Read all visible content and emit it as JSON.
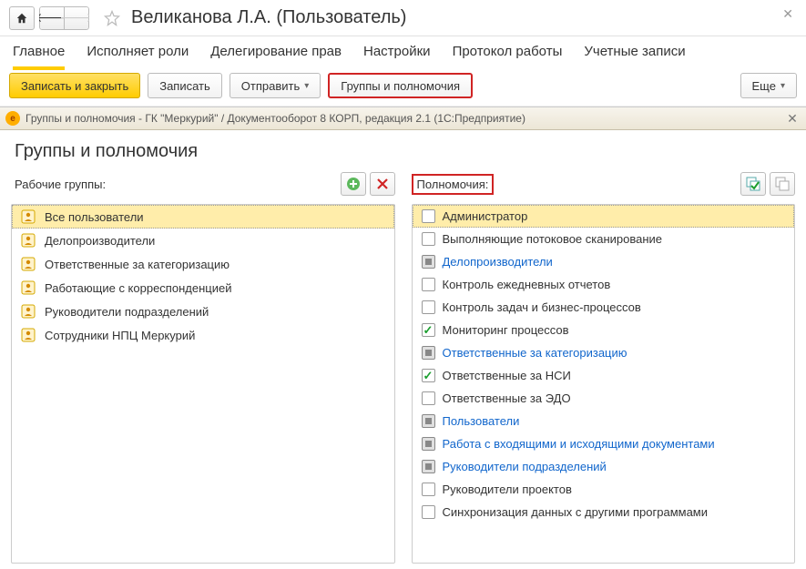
{
  "header": {
    "title": "Великанова Л.А. (Пользователь)"
  },
  "tabs": [
    {
      "label": "Главное",
      "active": true
    },
    {
      "label": "Исполняет роли",
      "active": false
    },
    {
      "label": "Делегирование прав",
      "active": false
    },
    {
      "label": "Настройки",
      "active": false
    },
    {
      "label": "Протокол работы",
      "active": false
    },
    {
      "label": "Учетные записи",
      "active": false
    }
  ],
  "toolbar": {
    "save_close": "Записать и закрыть",
    "save": "Записать",
    "send": "Отправить",
    "groups_perms": "Группы и полномочия",
    "more": "Еще"
  },
  "subwin": {
    "title_bar": "Группы и полномочия - ГК \"Меркурий\" / Документооборот 8 КОРП, редакция 2.1  (1С:Предприятие)",
    "heading": "Группы и полномочия"
  },
  "groups": {
    "label": "Рабочие группы:",
    "items": [
      {
        "label": "Все пользователи",
        "selected": true
      },
      {
        "label": "Делопроизводители"
      },
      {
        "label": "Ответственные за категоризацию"
      },
      {
        "label": "Работающие с корреспонденцией"
      },
      {
        "label": "Руководители подразделений"
      },
      {
        "label": "Сотрудники НПЦ Меркурий"
      }
    ]
  },
  "perms": {
    "label": "Полномочия:",
    "items": [
      {
        "label": "Администратор",
        "state": "empty",
        "selected": true,
        "link": false
      },
      {
        "label": "Выполняющие потоковое сканирование",
        "state": "empty",
        "link": false
      },
      {
        "label": "Делопроизводители",
        "state": "group",
        "link": true
      },
      {
        "label": "Контроль ежедневных отчетов",
        "state": "empty",
        "link": false
      },
      {
        "label": "Контроль задач и бизнес-процессов",
        "state": "empty",
        "link": false
      },
      {
        "label": "Мониторинг процессов",
        "state": "checked",
        "link": false
      },
      {
        "label": "Ответственные за категоризацию",
        "state": "group",
        "link": true
      },
      {
        "label": "Ответственные за НСИ",
        "state": "checked",
        "link": false
      },
      {
        "label": "Ответственные за ЭДО",
        "state": "empty",
        "link": false
      },
      {
        "label": "Пользователи",
        "state": "group",
        "link": true
      },
      {
        "label": "Работа с входящими и исходящими документами",
        "state": "group",
        "link": true
      },
      {
        "label": "Руководители подразделений",
        "state": "group",
        "link": true
      },
      {
        "label": "Руководители проектов",
        "state": "empty",
        "link": false
      },
      {
        "label": "Синхронизация данных с другими программами",
        "state": "empty",
        "link": false
      }
    ]
  }
}
